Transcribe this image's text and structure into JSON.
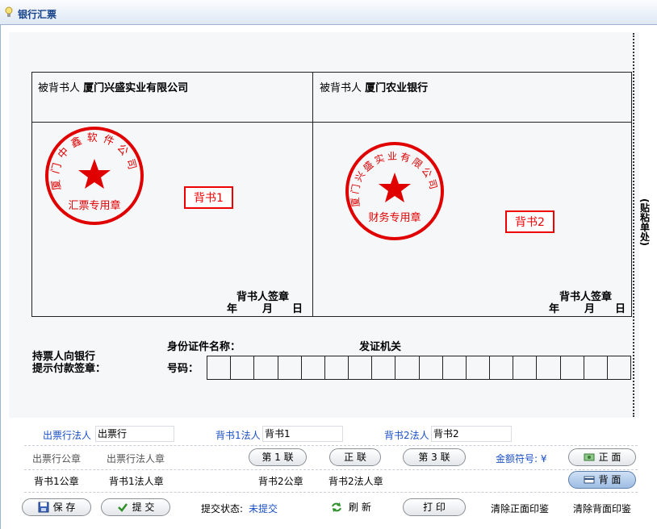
{
  "window": {
    "title": "银行汇票"
  },
  "bill": {
    "endorsee_label": "被背书人",
    "endorsee1_name": "厦门兴盛实业有限公司",
    "endorsee2_name": "厦门农业银行",
    "stamp1": {
      "top_text": "厦门中鑫软件公司",
      "bottom_text": "汇票专用章"
    },
    "stamp2": {
      "top_text": "厦门兴盛实业有限公司",
      "bottom_text": "财务专用章"
    },
    "endorse1_tag": "背书1",
    "endorse2_tag": "背书2",
    "signer_label": "背书人签章",
    "date_year": "年",
    "date_month": "月",
    "date_day": "日",
    "paste_label": "(贴粘单处)",
    "holder_line1": "持票人向银行",
    "holder_line2": "提示付款签章：",
    "id_name_label": "身份证件名称：",
    "issuer_label": "发证机关",
    "id_number_label": "号码：",
    "id_cells": 18,
    "stamp_color": "#e00000"
  },
  "form": {
    "issuer_legal_label": "出票行法人",
    "issuer_legal_value": "出票行",
    "endorser1_legal_label": "背书1法人",
    "endorser1_legal_value": "背书1",
    "endorser2_legal_label": "背书2法人",
    "endorser2_legal_value": "背书2",
    "issuer_seal": "出票行公章",
    "issuer_person_seal": "出票行法人章",
    "copy1": "第 1 联",
    "front_btn": "正 联",
    "copy3": "第 3 联",
    "currency_label": "金额符号: ¥",
    "front_face": "正 面",
    "endorser1_seal": "背书1公章",
    "endorser1_person_seal": "背书1法人章",
    "endorser2_seal": "背书2公章",
    "endorser2_person_seal": "背书2法人章",
    "back_face": "背 面",
    "save": "保 存",
    "submit": "提 交",
    "submit_status_label": "提交状态:",
    "submit_status_value": "未提交",
    "refresh": "刷 新",
    "print": "打 印",
    "clear_front": "清除正面印鉴",
    "clear_back": "清除背面印鉴"
  }
}
